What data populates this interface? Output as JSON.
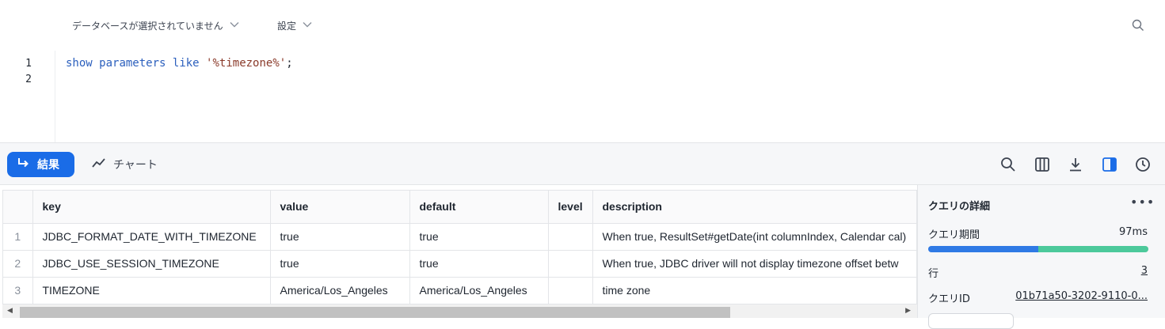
{
  "topbar": {
    "database_selector": "データベースが選択されていません",
    "settings_label": "設定"
  },
  "editor": {
    "line_numbers": [
      "1",
      "2"
    ],
    "code": {
      "kw1": "show",
      "kw2": "parameters",
      "kw3": "like",
      "literal": "'%timezone%'",
      "terminator": ";"
    }
  },
  "results_toolbar": {
    "results_tab": "結果",
    "chart_tab": "チャート"
  },
  "grid": {
    "columns": [
      "key",
      "value",
      "default",
      "level",
      "description"
    ],
    "rows": [
      {
        "n": "1",
        "key": "JDBC_FORMAT_DATE_WITH_TIMEZONE",
        "value": "true",
        "default": "true",
        "level": "",
        "description": "When true, ResultSet#getDate(int columnIndex, Calendar cal)"
      },
      {
        "n": "2",
        "key": "JDBC_USE_SESSION_TIMEZONE",
        "value": "true",
        "default": "true",
        "level": "",
        "description": "When true, JDBC driver will not display timezone offset betw"
      },
      {
        "n": "3",
        "key": "TIMEZONE",
        "value": "America/Los_Angeles",
        "default": "America/Los_Angeles",
        "level": "",
        "description": "time zone"
      }
    ]
  },
  "details": {
    "title": "クエリの詳細",
    "more": "•••",
    "duration_label": "クエリ期間",
    "duration_value": "97ms",
    "duration_split": 0.5,
    "rows_label": "行",
    "rows_value": "3",
    "query_id_label": "クエリID",
    "query_id_value": "01b71a50-3202-9110-0..."
  },
  "colors": {
    "accent": "#1a6ce7",
    "bar_primary": "#2f7ae5",
    "bar_secondary": "#4cc99b"
  }
}
